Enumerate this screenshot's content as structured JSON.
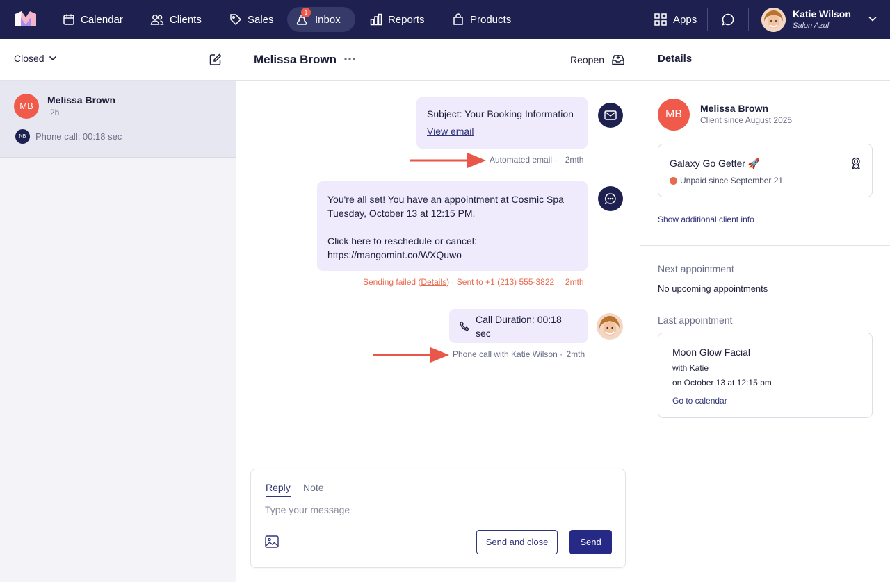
{
  "nav": {
    "calendar": "Calendar",
    "clients": "Clients",
    "sales": "Sales",
    "inbox": "Inbox",
    "inbox_badge": "1",
    "reports": "Reports",
    "products": "Products",
    "apps": "Apps"
  },
  "user": {
    "name": "Katie Wilson",
    "salon": "Salon Azul"
  },
  "sidebar": {
    "filter_label": "Closed",
    "conversations": [
      {
        "initials": "MB",
        "name": "Melissa Brown",
        "time": "2h",
        "preview_initials": "NB",
        "preview": "Phone call: 00:18 sec"
      }
    ]
  },
  "conversation": {
    "title": "Melissa Brown",
    "reopen_label": "Reopen",
    "messages": [
      {
        "type": "email",
        "subject": "Subject: Your Booking Information",
        "link": "View email",
        "meta_label": "Automated email",
        "meta_time": "2mth"
      },
      {
        "type": "sms",
        "line1": "You're all set! You have an appointment at Cosmic Spa",
        "line2": "Tuesday, October 13 at 12:15 PM.",
        "line3": "Click here to reschedule or cancel:",
        "line4": "https://mangomint.co/WXQuwo",
        "fail_prefix": "Sending failed (",
        "fail_link": "Details",
        "fail_suffix": ")",
        "sent_to": "Sent to +1 (213) 555-3822",
        "meta_time": "2mth"
      },
      {
        "type": "call",
        "text": "Call Duration: 00:18 sec",
        "meta_label": "Phone call with Katie Wilson",
        "meta_time": "2mth"
      }
    ],
    "separator": "·"
  },
  "composer": {
    "tab_reply": "Reply",
    "tab_note": "Note",
    "placeholder": "Type your message",
    "send_close": "Send and close",
    "send": "Send"
  },
  "details": {
    "title": "Details",
    "client_initials": "MB",
    "client_name": "Melissa Brown",
    "client_since": "Client since August 2025",
    "membership_name": "Galaxy Go Getter 🚀",
    "membership_status": "Unpaid since September 21",
    "show_more": "Show additional client info",
    "next_label": "Next appointment",
    "next_value": "No upcoming appointments",
    "last_label": "Last appointment",
    "last": {
      "service": "Moon Glow Facial",
      "with": "with Katie",
      "on": "on October 13 at 12:15 pm",
      "link": "Go to calendar"
    }
  },
  "colors": {
    "nav_bg": "#1e2150",
    "accent": "#262985",
    "brand_red": "#ef5a4a",
    "bubble": "#efeafc",
    "fail": "#e86a4f"
  }
}
